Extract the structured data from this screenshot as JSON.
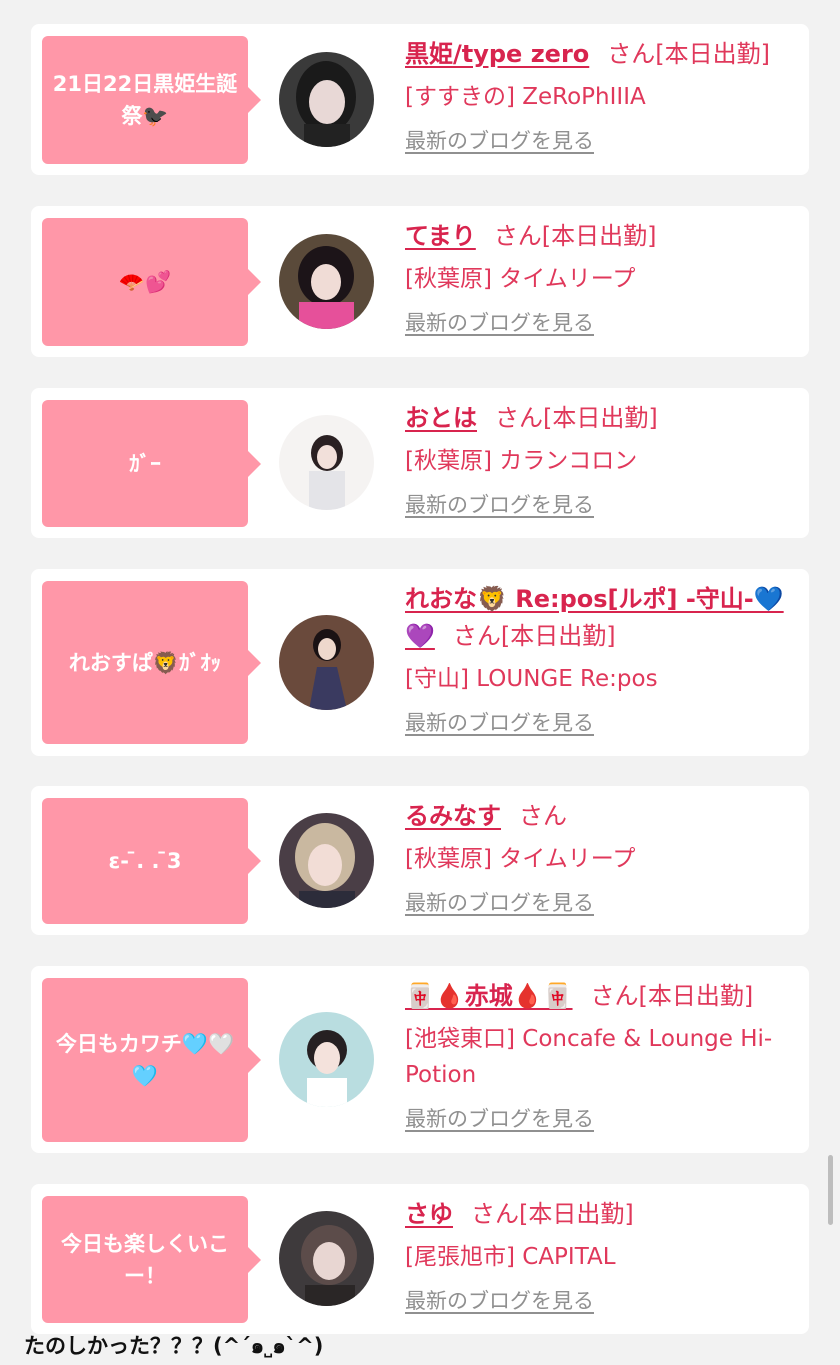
{
  "cards": [
    {
      "bubble": "21日22日黒姫生誕祭🐦‍⬛",
      "name": "黒姫/type zero",
      "honorific": "さん[本日出勤]",
      "shop": "[すすきの] ZeRoPhIIIA",
      "blog_link": "最新のブログを見る"
    },
    {
      "bubble": "🪭💕",
      "name": "てまり",
      "honorific": "さん[本日出勤]",
      "shop": "[秋葉原] タイムリープ",
      "blog_link": "最新のブログを見る"
    },
    {
      "bubble": "ｶﾞｰ",
      "name": "おとは",
      "honorific": "さん[本日出勤]",
      "shop": "[秋葉原] カランコロン",
      "blog_link": "最新のブログを見る"
    },
    {
      "bubble": "れおすぱ🦁ｶﾞｵｯ",
      "name": "れおな🦁 Re:pos[ルポ] -守山-💙💜",
      "honorific": "さん[本日出勤]",
      "shop": "[守山] LOUNGE Re:pos",
      "blog_link": "最新のブログを見る"
    },
    {
      "bubble": "ε- ̄. . ̄3",
      "name": "るみなす",
      "honorific": "さん",
      "shop": "[秋葉原] タイムリープ",
      "blog_link": "最新のブログを見る"
    },
    {
      "bubble": "今日もカワチ🩵🤍🩵",
      "name": "🀄🩸赤城🩸🀄",
      "honorific": "さん[本日出勤]",
      "shop": "[池袋東口] Concafe & Lounge Hi-Potion",
      "blog_link": "最新のブログを見る"
    },
    {
      "bubble": "今日も楽しくいこー！",
      "name": "さゆ",
      "honorific": "さん[本日出勤]",
      "shop": "[尾張旭市] CAPITAL",
      "blog_link": "最新のブログを見る"
    }
  ],
  "footer_caption": "たのしかった？？？(^ˊ๑˽๑ˋ^)",
  "colors": {
    "accent": "#d8244e",
    "bubble": "#ff97a8",
    "background": "#f2f2f2"
  }
}
